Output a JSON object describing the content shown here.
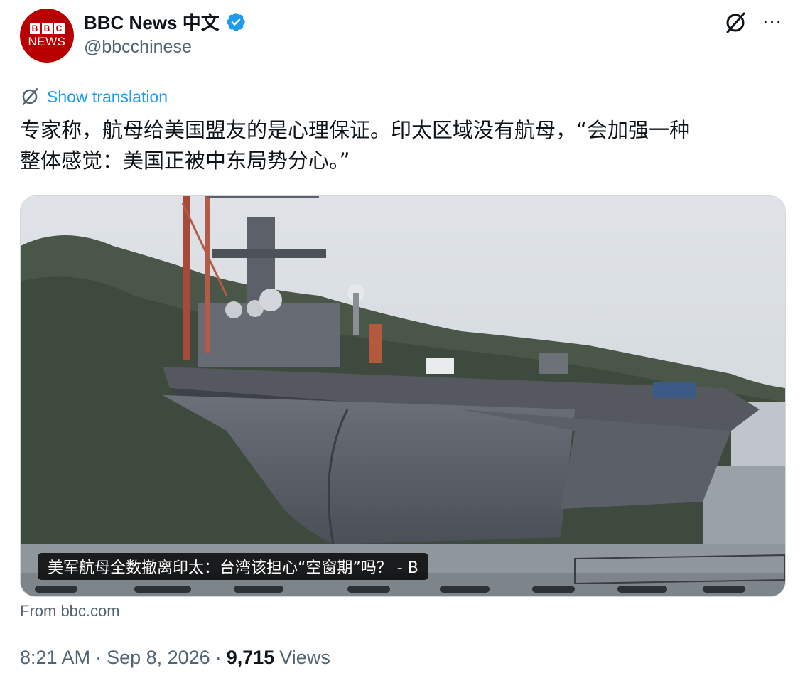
{
  "account": {
    "avatar_top": "BBC",
    "avatar_bottom": "NEWS",
    "name": "BBC News 中文",
    "handle": "@bbcchinese",
    "verified_icon": "verified-badge-icon"
  },
  "actions": {
    "grok_icon": "grok-icon",
    "more_icon": "more-icon",
    "more_glyph": "···"
  },
  "translation": {
    "label": "Show translation",
    "icon": "translate-icon"
  },
  "tweet": {
    "text": "专家称，航母给美国盟友的是心理保证。印太区域没有航母，“会加强一种\n整体感觉：美国正被中东局势分心。”"
  },
  "card": {
    "headline": "美军航母全数撤离印太：台湾该担心“空窗期”吗？ - B",
    "source": "From bbc.com"
  },
  "meta": {
    "time": "8:21 AM",
    "sep1": "·",
    "date": "Sep 8, 2026",
    "sep2": "·",
    "views_count": "9,715",
    "views_label": "Views"
  },
  "colors": {
    "accent": "#1d9bf0",
    "brand": "#b80000",
    "text": "#0f1419",
    "secondary": "#536471"
  }
}
